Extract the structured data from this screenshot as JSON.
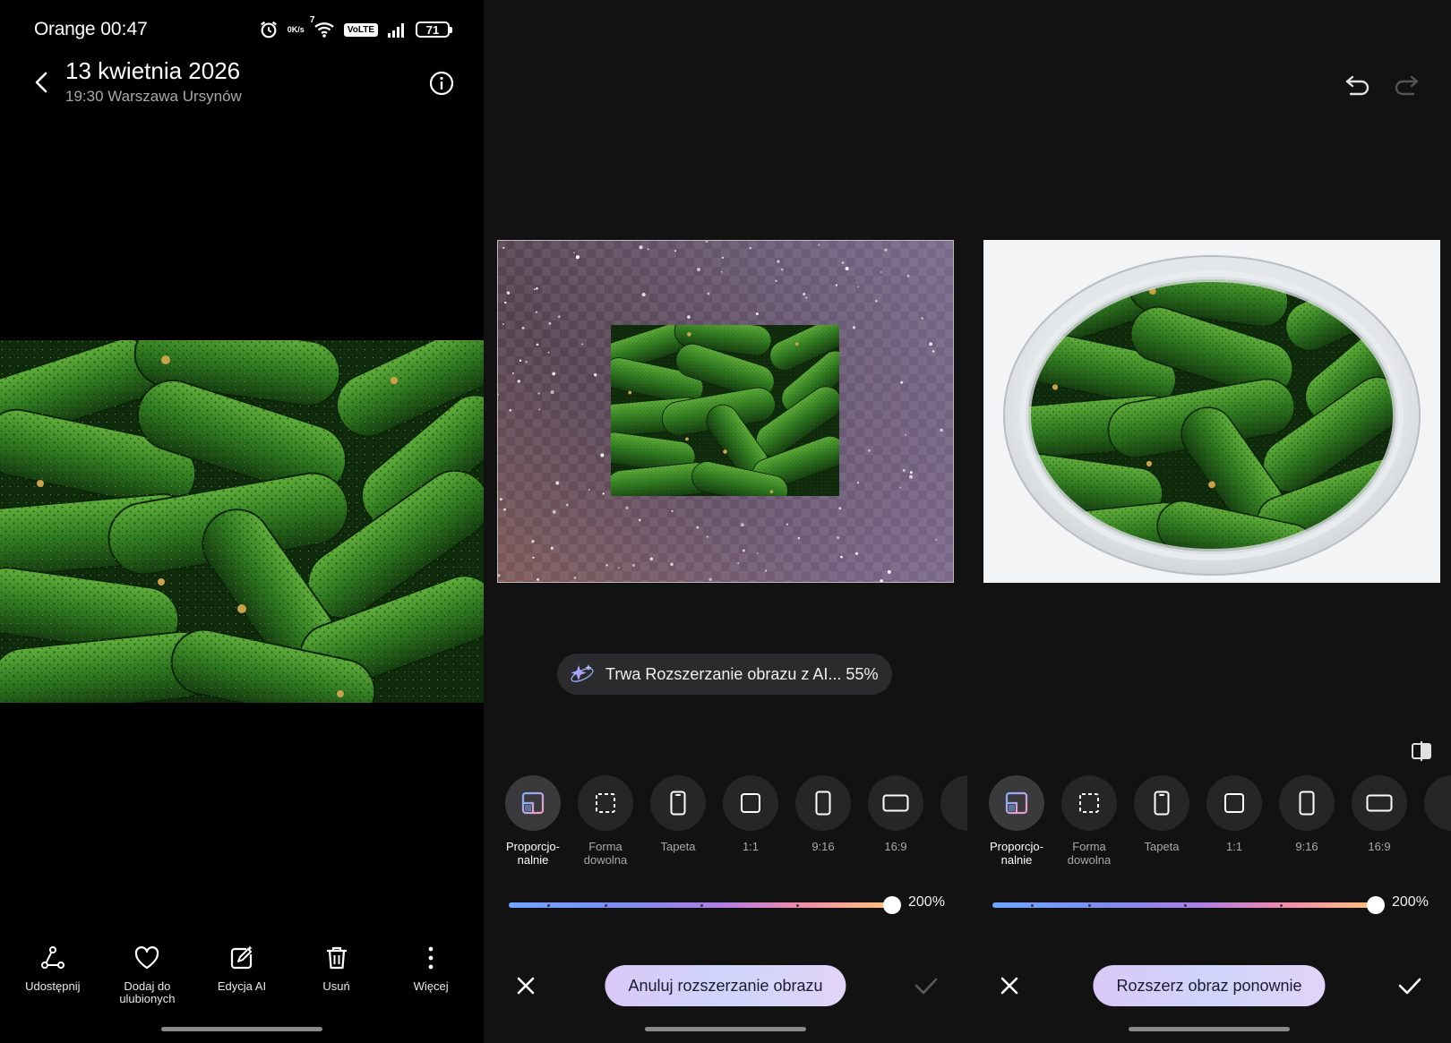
{
  "status_bar": {
    "carrier": "Orange",
    "time": "00:47",
    "net_speed_top": "0",
    "net_speed_unit": "K/s",
    "wifi_badge": "7",
    "volte": "VoLTE",
    "battery": "71"
  },
  "viewer": {
    "title": "13 kwietnia 2026",
    "subtitle": "19:30 Warszawa Ursynów",
    "actions": [
      {
        "label": "Udostępnij",
        "icon": "share-icon"
      },
      {
        "label": "Dodaj do\nulubionych",
        "icon": "heart-icon"
      },
      {
        "label": "Edycja AI",
        "icon": "ai-edit-icon"
      },
      {
        "label": "Usuń",
        "icon": "trash-icon"
      },
      {
        "label": "Więcej",
        "icon": "more-vertical-icon"
      }
    ]
  },
  "editor_progress": {
    "progress_text": "Trwa Rozszerzanie obrazu z AI... 55%",
    "progress_percent": 55,
    "tools": [
      {
        "label": "Proporcjo-\nnalnie",
        "icon": "proportional-icon",
        "active": true
      },
      {
        "label": "Forma\ndowolna",
        "icon": "freeform-icon",
        "active": false
      },
      {
        "label": "Tapeta",
        "icon": "wallpaper-icon",
        "active": false
      },
      {
        "label": "1:1",
        "icon": "square-icon",
        "active": false
      },
      {
        "label": "9:16",
        "icon": "portrait-icon",
        "active": false
      },
      {
        "label": "16:9",
        "icon": "landscape-icon",
        "active": false
      }
    ],
    "slider_value": "200%",
    "slider_fraction": 1.0,
    "primary_button": "Anuluj rozszerzanie obrazu"
  },
  "editor_done": {
    "tools": [
      {
        "label": "Proporcjo-\nnalnie",
        "icon": "proportional-icon",
        "active": true
      },
      {
        "label": "Forma\ndowolna",
        "icon": "freeform-icon",
        "active": false
      },
      {
        "label": "Tapeta",
        "icon": "wallpaper-icon",
        "active": false
      },
      {
        "label": "1:1",
        "icon": "square-icon",
        "active": false
      },
      {
        "label": "9:16",
        "icon": "portrait-icon",
        "active": false
      },
      {
        "label": "16:9",
        "icon": "landscape-icon",
        "active": false
      }
    ],
    "slider_value": "200%",
    "slider_fraction": 1.0,
    "primary_button": "Rozszerz obraz ponownie"
  },
  "colors": {
    "background": "#000000",
    "editor_background": "#121212",
    "cucumber_dark": "#1f4a16",
    "cucumber_light": "#4d9b2e",
    "accent_button": "#d9c8f7"
  }
}
